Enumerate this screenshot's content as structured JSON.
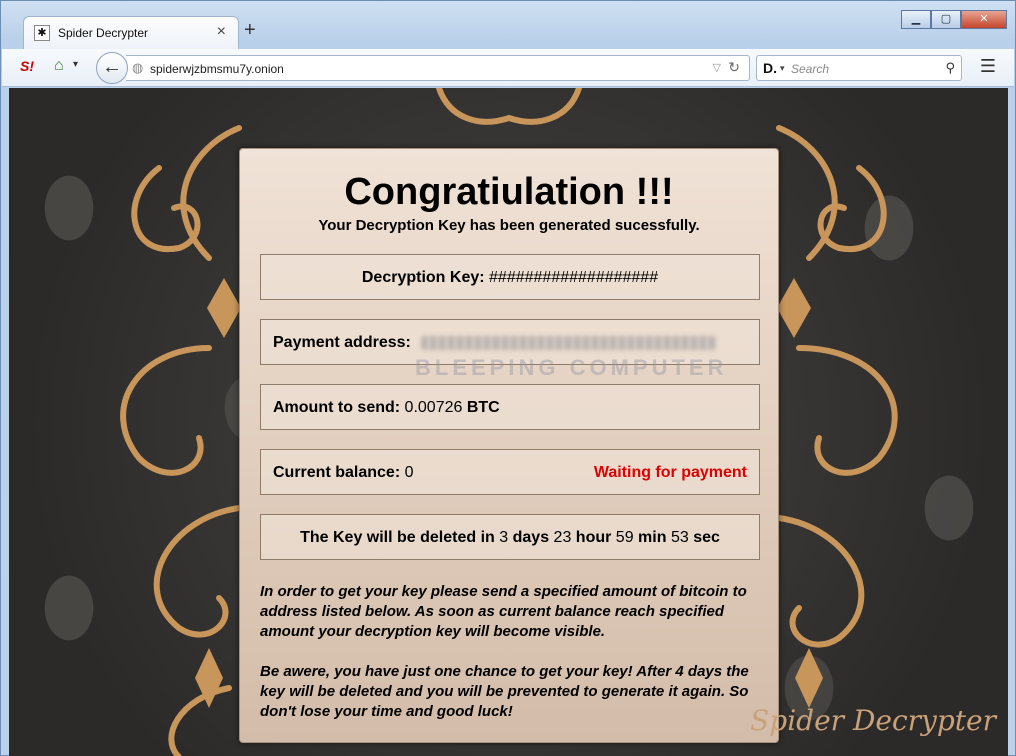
{
  "browser": {
    "tab_title": "Spider Decrypter",
    "url": "spiderwjzbmsmu7y.onion",
    "search_placeholder": "Search"
  },
  "page": {
    "headline": "Congratiulation !!!",
    "subheadline": "Your Decryption Key has been generated sucessfully.",
    "key": {
      "label": "Decryption Key:",
      "value": "###################"
    },
    "payment": {
      "label": "Payment address:"
    },
    "amount": {
      "label": "Amount to send:",
      "value": "0.00726",
      "unit": "BTC"
    },
    "balance": {
      "label": "Current balance:",
      "value": "0",
      "status": "Waiting for payment"
    },
    "timer": {
      "prefix": "The Key will be deleted in",
      "days": "3",
      "days_unit": "days",
      "hours": "23",
      "hours_unit": "hour",
      "minutes": "59",
      "minutes_unit": "min",
      "seconds": "53",
      "seconds_unit": "sec"
    },
    "instructions": "In order to get your key please send a specified amount of bitcoin to address listed below. As soon as current balance reach specified amount your decryption key will become visible.",
    "warning": "Be awere, you have just one chance to get your key! After 4 days the key will be deleted and you will be prevented to generate it again. So don't lose your time and good luck!",
    "watermark": "BLEEPING COMPUTER",
    "signature": "Spider Decrypter"
  },
  "colors": {
    "status_red": "#e00000",
    "panel": "#e8d8ca",
    "gold": "#caa27a"
  },
  "icons": [
    "spider-favicon-icon",
    "close-icon",
    "plus-icon",
    "minimize-icon",
    "maximize-icon",
    "window-close-icon",
    "back-arrow-icon",
    "globe-icon",
    "reload-icon",
    "dropdown-icon",
    "search-icon",
    "menu-icon",
    "home-icon"
  ]
}
